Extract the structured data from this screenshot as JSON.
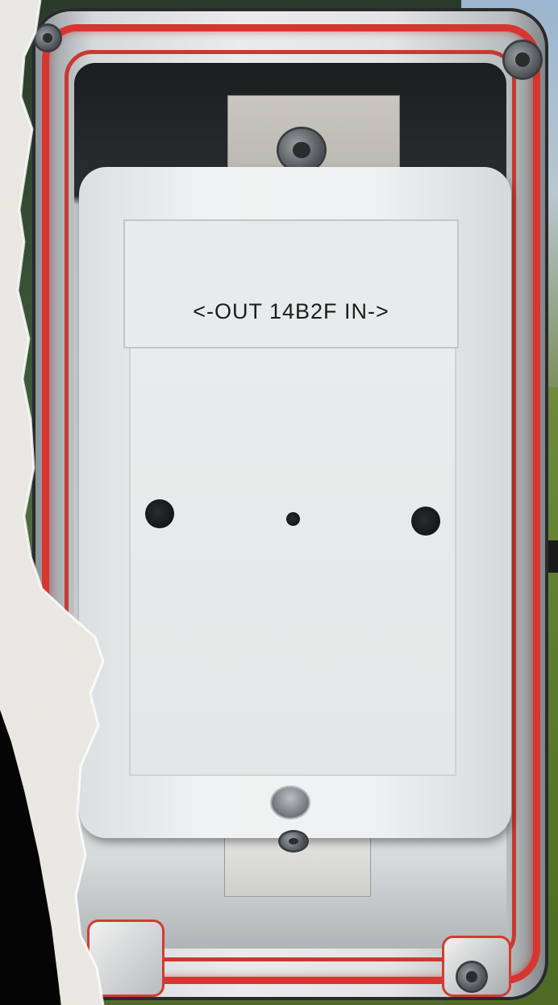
{
  "photo": {
    "label_text": "<-OUT 14B2F IN->"
  },
  "colors": {
    "gasket_red": "#d6362f",
    "faceplate_white": "#eef0f1",
    "paper_texture": "#e9e6e0"
  }
}
